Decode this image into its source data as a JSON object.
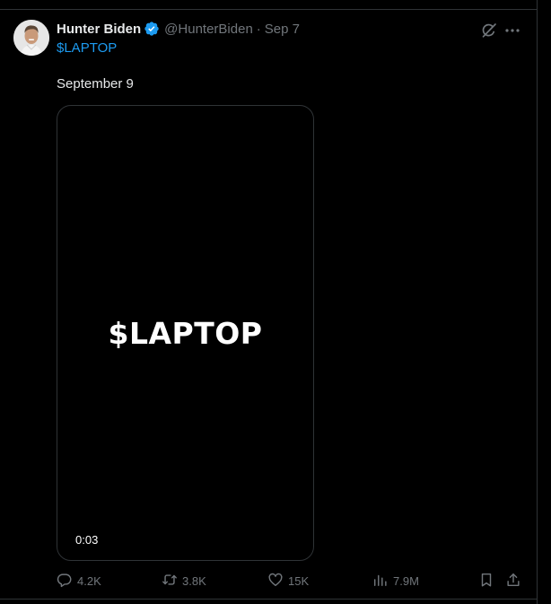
{
  "tweet": {
    "author": {
      "display_name": "Hunter Biden",
      "handle": "@HunterBiden",
      "verified": true
    },
    "separator": "·",
    "date": "Sep 7",
    "cashtag": "$LAPTOP",
    "text": "September 9",
    "media": {
      "overlay_text": "$LAPTOP",
      "duration": "0:03"
    },
    "stats": {
      "replies": "4.2K",
      "reposts": "3.8K",
      "likes": "15K",
      "views": "7.9M"
    }
  },
  "colors": {
    "background": "#000000",
    "text": "#e7e9ea",
    "muted": "#71767b",
    "link": "#1d9bf0",
    "verified": "#1d9bf0",
    "border": "#2f3336"
  },
  "icons": {
    "avatar": "avatar-photo",
    "verified": "verified-badge-icon",
    "grok": "grok-icon",
    "more": "more-icon",
    "reply": "reply-icon",
    "repost": "repost-icon",
    "like": "like-icon",
    "views": "views-icon",
    "bookmark": "bookmark-icon",
    "share": "share-icon"
  }
}
